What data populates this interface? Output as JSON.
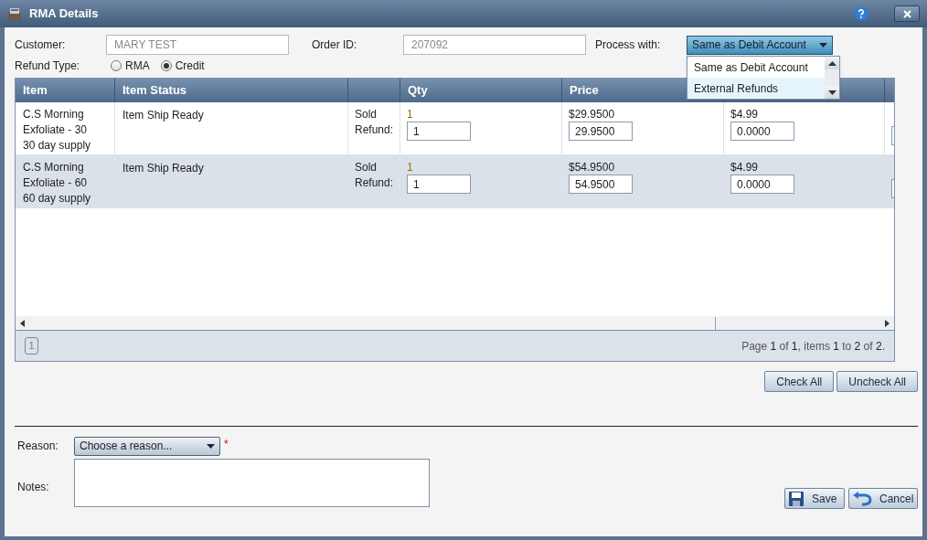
{
  "window": {
    "title": "RMA Details"
  },
  "form": {
    "customer_label": "Customer:",
    "customer": "MARY TEST",
    "order_id_label": "Order ID:",
    "order_id": "207092",
    "process_label": "Process with:",
    "process_value": "Same as Debit Account",
    "process_options": [
      {
        "label": "Same as Debit Account",
        "highlighted": false
      },
      {
        "label": "External Refunds",
        "highlighted": true
      }
    ],
    "refund_type_label": "Refund Type:",
    "refund_types": [
      {
        "label": "RMA",
        "selected": false
      },
      {
        "label": "Credit",
        "selected": true
      }
    ]
  },
  "table": {
    "columns": {
      "item": "Item",
      "item_status": "Item Status",
      "qty": "Qty",
      "price": "Price"
    },
    "rows": [
      {
        "name": "C.S Morning Exfoliate - 30",
        "description": "30 day supply",
        "status": "Item Ship Ready",
        "sold_label": "Sold",
        "refund_label": "Refund:",
        "qty_sold": "1",
        "qty_refund": "1",
        "price": "$29.9500",
        "price_refund": "29.9500",
        "column_6": "$4.99",
        "column_6_refund": "0.0000",
        "selected": false
      },
      {
        "name": "C.S Morning Exfoliate - 60",
        "description": "60 day supply",
        "status": "Item Ship Ready",
        "sold_label": "Sold",
        "refund_label": "Refund:",
        "qty_sold": "1",
        "qty_refund": "1",
        "price": "$54.9500",
        "price_refund": "54.9500",
        "column_6": "$4.99",
        "column_6_refund": "0.0000",
        "selected": true
      }
    ],
    "pager": {
      "pages": [
        {
          "label": "1",
          "selected": true
        }
      ],
      "summary": "Page **1** of **1**, items **1** to **2** of **2**."
    }
  },
  "check_all": "Check All",
  "uncheck_all": "Uncheck All",
  "reason": {
    "label": "Reason:",
    "placeholder": "Choose a reason...",
    "required": "*"
  },
  "notes": {
    "label": "Notes:"
  },
  "buttons": {
    "save": "Save",
    "cancel": "Cancel"
  }
}
